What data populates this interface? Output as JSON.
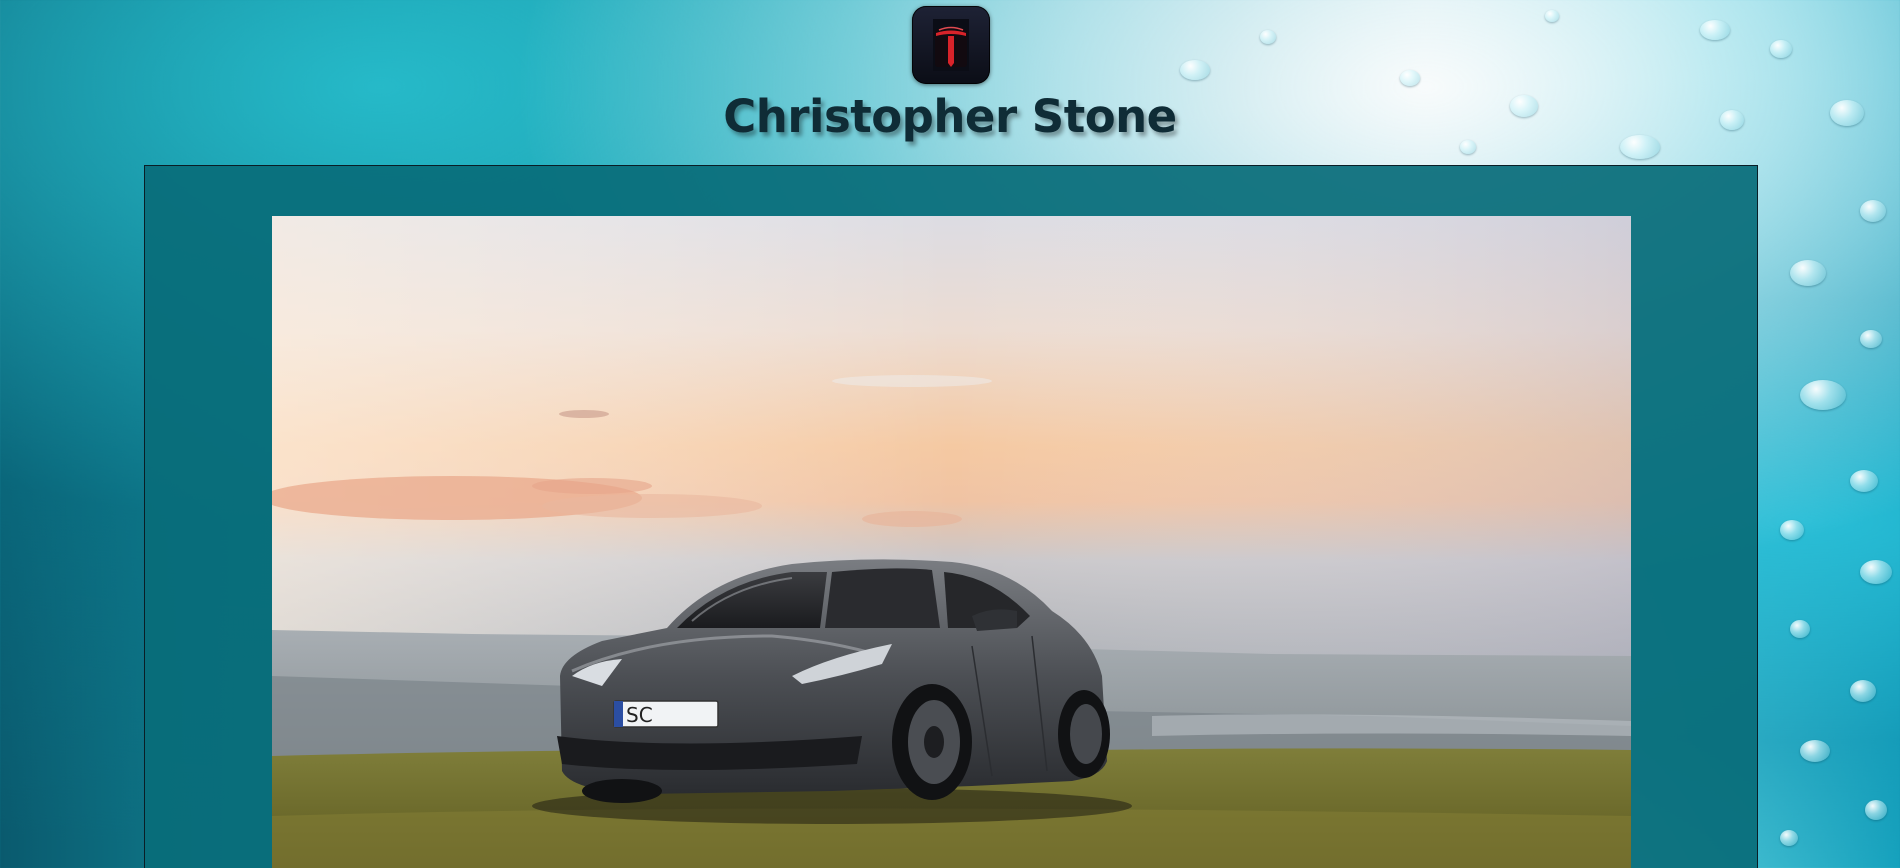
{
  "site": {
    "title": "Christopher Stone",
    "logo_icon": "tesla-logo-icon"
  },
  "hero": {
    "image_description_icon": "car-photo",
    "license_plate": "SC"
  },
  "colors": {
    "card_background": "#096d7a",
    "title_color": "#0f2c36",
    "logo_accent": "#d8232a"
  }
}
